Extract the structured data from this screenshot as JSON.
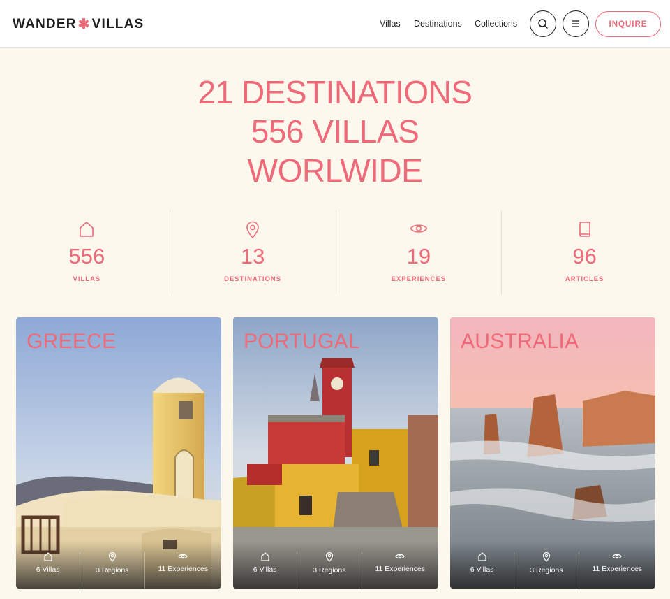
{
  "header": {
    "logo_left": "WANDER",
    "logo_star": "✱",
    "logo_right": "VILLAS",
    "nav": [
      "Villas",
      "Destinations",
      "Collections"
    ],
    "inquire_label": "INQUIRE"
  },
  "hero": {
    "line1": "21 DESTINATIONS",
    "line2": "556 VILLAS",
    "line3": "WORLWIDE"
  },
  "stats": [
    {
      "icon": "house-icon",
      "value": "556",
      "label": "VILLAS"
    },
    {
      "icon": "map-pin-icon",
      "value": "13",
      "label": "DESTINATIONS"
    },
    {
      "icon": "eye-icon",
      "value": "19",
      "label": "EXPERIENCES"
    },
    {
      "icon": "book-icon",
      "value": "96",
      "label": "ARTICLES"
    }
  ],
  "cards": [
    {
      "title": "GREECE",
      "villas": "6 Villas",
      "regions": "3 Regions",
      "experiences": "11 Experiences"
    },
    {
      "title": "PORTUGAL",
      "villas": "6 Villas",
      "regions": "3 Regions",
      "experiences": "11 Experiences"
    },
    {
      "title": "AUSTRALIA",
      "villas": "6 Villas",
      "regions": "3 Regions",
      "experiences": "11 Experiences"
    }
  ],
  "colors": {
    "accent": "#ee6a78",
    "background": "#fdf8ee",
    "text": "#1d1d1d"
  }
}
